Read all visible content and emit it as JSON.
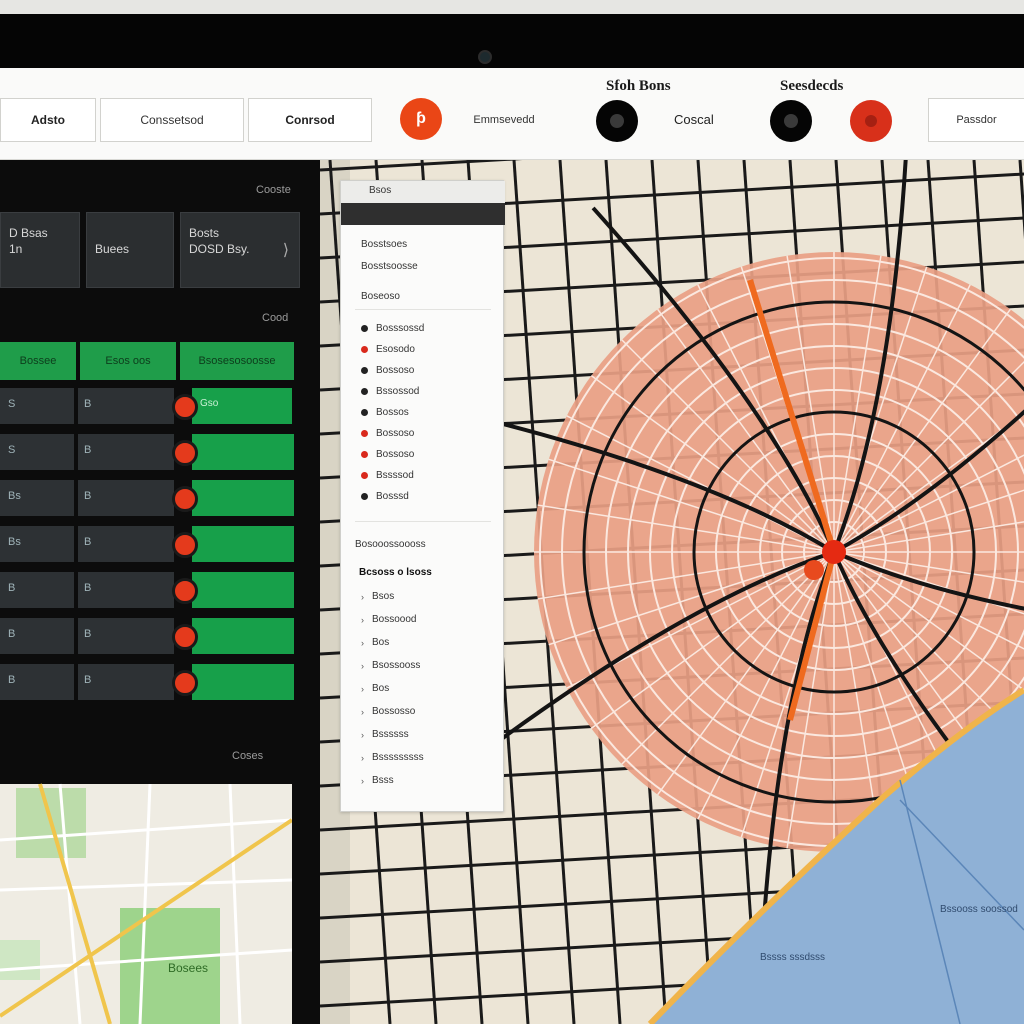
{
  "toolbar": {
    "btn1_label": "Adsto",
    "btn2_label": "Conssetsod",
    "btn3_label": "Conrsod",
    "btn4_label": "Emmsevedd",
    "heading1": "Sfoh Bons",
    "label1": "Coscal",
    "heading2": "Seesdecds",
    "btn5_label": "Passdor"
  },
  "left_panel": {
    "top_label": "Cooste",
    "cards": [
      {
        "line1": "D Bsas",
        "line2": "1n"
      },
      {
        "line1": "Buees",
        "line2": ""
      },
      {
        "line1": "Bosts",
        "line2": "DOSD Bsy."
      }
    ],
    "section_label": "Cood",
    "green_headers": [
      "Bossee",
      "Esos oos",
      "Bsosesosoosse"
    ],
    "rows": [
      {
        "c1": "S",
        "c2": "B",
        "bar": "Gso"
      },
      {
        "c1": "S",
        "c2": "B",
        "bar": ""
      },
      {
        "c1": "Bs",
        "c2": "B",
        "bar": ""
      },
      {
        "c1": "Bs",
        "c2": "B",
        "bar": ""
      },
      {
        "c1": "B",
        "c2": "B",
        "bar": ""
      },
      {
        "c1": "B",
        "c2": "B",
        "bar": ""
      },
      {
        "c1": "B",
        "c2": "B",
        "bar": ""
      }
    ],
    "footer_label": "Coses",
    "map_label": "Bosees"
  },
  "legend": {
    "tab": "Bsos",
    "group1": [
      "Bosstsoes",
      "Bosstsoosse",
      "Boseoso"
    ],
    "group2": [
      {
        "label": "Bosssossd",
        "color": "#222222"
      },
      {
        "label": "Esosodo",
        "color": "#d9291c"
      },
      {
        "label": "Bossoso",
        "color": "#222222"
      },
      {
        "label": "Bssossod",
        "color": "#222222"
      },
      {
        "label": "Bossos",
        "color": "#222222"
      },
      {
        "label": "Bossoso",
        "color": "#d9291c"
      },
      {
        "label": "Bossoso",
        "color": "#d9291c"
      },
      {
        "label": "Bssssod",
        "color": "#d9291c"
      },
      {
        "label": "Bosssd",
        "color": "#222222"
      }
    ],
    "section2_title": "Bosooossoooss",
    "section2_subtitle": "Bcsoss o lsoss",
    "group3": [
      "Bsos",
      "Bossoood",
      "Bos",
      "Bsossooss",
      "Bos",
      "Bossosso",
      "Bssssss",
      "Bsssssssss",
      "Bsss"
    ]
  },
  "map": {
    "label_sea1": "Bssooss soossod",
    "label_sea2": "Bssss sssdsss"
  },
  "colors": {
    "accent_red": "#e4401c",
    "panel_green": "#1f9d4a",
    "sea_blue": "#8fb1d6",
    "heat_salmon": "#e9a084"
  }
}
